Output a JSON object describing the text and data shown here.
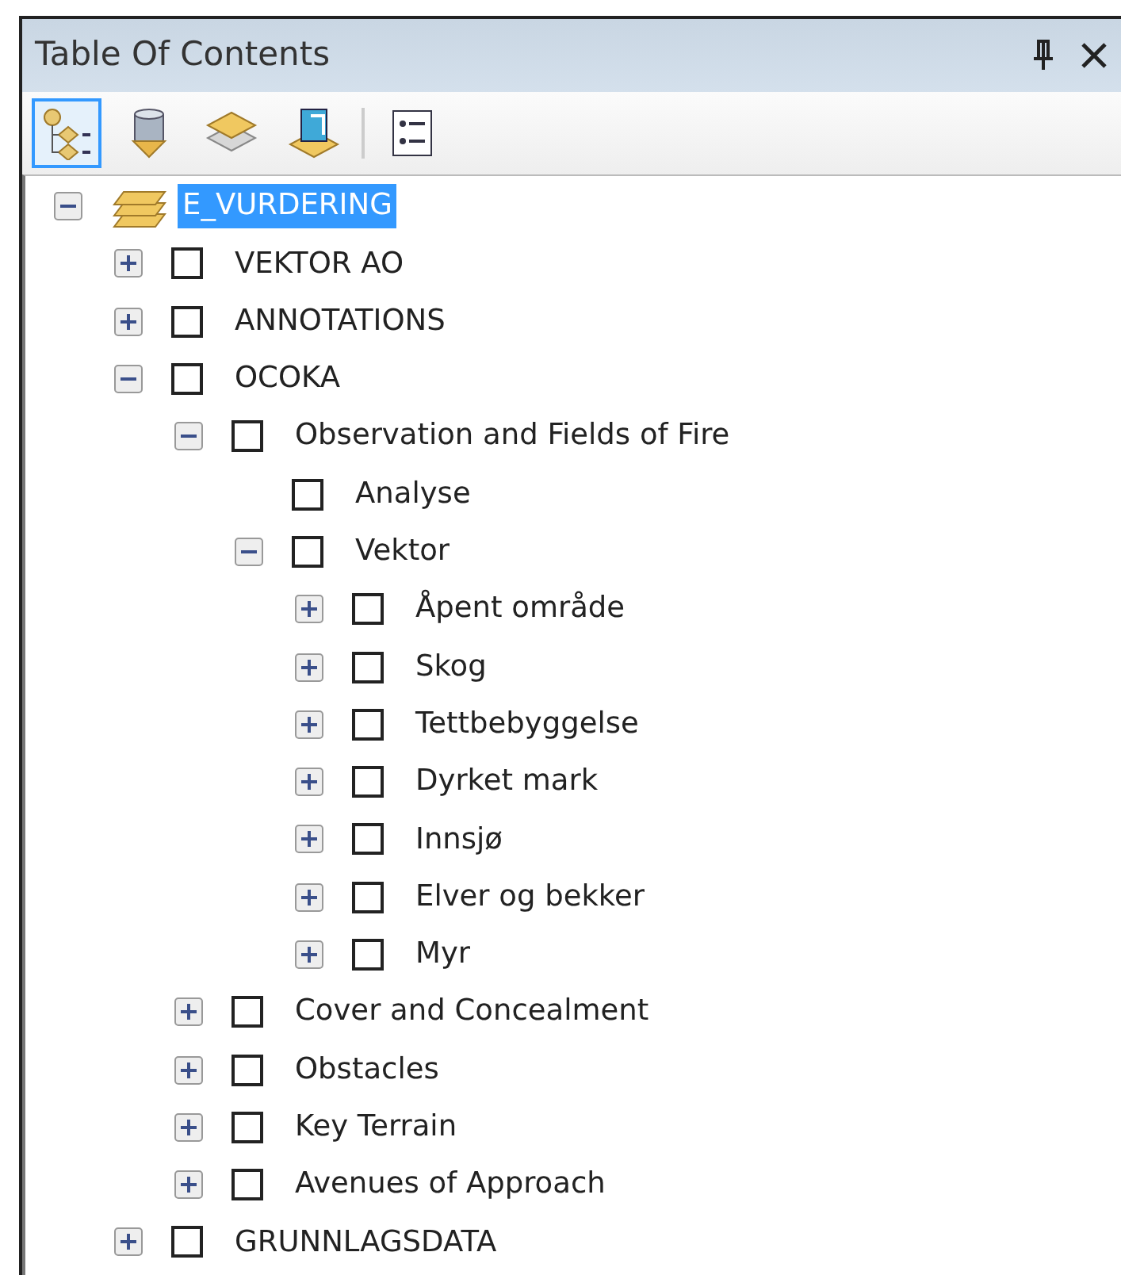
{
  "window": {
    "title": "Table Of Contents"
  },
  "toolbar": [
    {
      "selected": true
    },
    {
      "selected": false
    },
    {
      "selected": false
    },
    {
      "selected": false
    },
    {
      "selected": false
    }
  ],
  "tree": {
    "label": "E_VURDERING",
    "selected": true,
    "expanded": true,
    "children": [
      {
        "label": "VEKTOR AO",
        "checked": false,
        "expanded": false
      },
      {
        "label": "ANNOTATIONS",
        "checked": false,
        "expanded": false
      },
      {
        "label": "OCOKA",
        "checked": false,
        "expanded": true,
        "children": [
          {
            "label": "Observation and Fields of Fire",
            "checked": false,
            "expanded": true,
            "children": [
              {
                "label": "Analyse",
                "checked": false
              },
              {
                "label": "Vektor",
                "checked": false,
                "expanded": true,
                "children": [
                  {
                    "label": "Åpent område",
                    "checked": false,
                    "expanded": false
                  },
                  {
                    "label": "Skog",
                    "checked": false,
                    "expanded": false
                  },
                  {
                    "label": "Tettbebyggelse",
                    "checked": false,
                    "expanded": false
                  },
                  {
                    "label": "Dyrket mark",
                    "checked": false,
                    "expanded": false
                  },
                  {
                    "label": "Innsjø",
                    "checked": false,
                    "expanded": false
                  },
                  {
                    "label": "Elver og bekker",
                    "checked": false,
                    "expanded": false
                  },
                  {
                    "label": "Myr",
                    "checked": false,
                    "expanded": false
                  }
                ]
              }
            ]
          },
          {
            "label": "Cover and Concealment",
            "checked": false,
            "expanded": false
          },
          {
            "label": "Obstacles",
            "checked": false,
            "expanded": false
          },
          {
            "label": "Key Terrain",
            "checked": false,
            "expanded": false
          },
          {
            "label": "Avenues of Approach",
            "checked": false,
            "expanded": false
          }
        ]
      },
      {
        "label": "GRUNNLAGSDATA",
        "checked": false,
        "expanded": false
      }
    ]
  }
}
